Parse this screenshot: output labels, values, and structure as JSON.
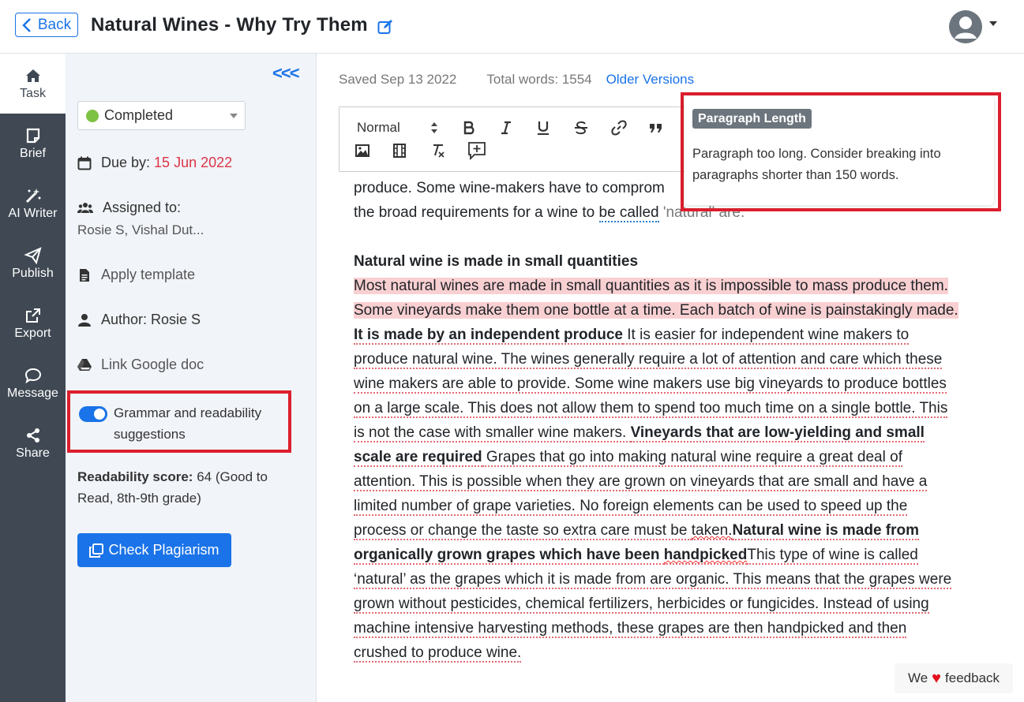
{
  "header": {
    "back_label": "Back",
    "title": "Natural Wines - Why Try Them"
  },
  "rail": {
    "items": [
      {
        "label": "Task",
        "icon": "home-icon"
      },
      {
        "label": "Brief",
        "icon": "note-icon"
      },
      {
        "label": "AI Writer",
        "icon": "magic-wand-icon"
      },
      {
        "label": "Publish",
        "icon": "send-icon"
      },
      {
        "label": "Export",
        "icon": "share-out-icon"
      },
      {
        "label": "Message",
        "icon": "chat-icon"
      },
      {
        "label": "Share",
        "icon": "share-icon"
      }
    ]
  },
  "panel": {
    "collapse_label": "<<<",
    "status": "Completed",
    "status_color": "#7dc243",
    "due_label": "Due by:",
    "due_date": "15 Jun 2022",
    "assigned_label": "Assigned to:",
    "assigned_names": "Rosie S, Vishal Dut...",
    "apply_template": "Apply template",
    "author": "Author: Rosie S",
    "link_google": "Link Google doc",
    "grammar_label": "Grammar and readability suggestions",
    "grammar_enabled": true,
    "readability_label": "Readability score:",
    "readability_value": "64 (Good to Read, 8th-9th grade)",
    "plagiarism_button": "Check Plagiarism"
  },
  "editor": {
    "saved": "Saved Sep 13 2022",
    "total_words": "Total words: 1554",
    "older_versions": "Older Versions",
    "toolbar": {
      "format_select": "Normal"
    },
    "line1": {
      "text": "produce. Some wine-makers have to comprom"
    },
    "line2": {
      "a": "the broad requirements for a wine to ",
      "b": "be called",
      "c": " 'natural' are:"
    },
    "heading": "Natural wine is made in small quantities",
    "hl_text": "Most natural wines are made in small quantities as it is impossible to mass produce them. Some vineyards make them one bottle at a time. Each batch of wine is painstakingly made.",
    "bold1": "It is made by an independent produce",
    "para1": " It is easier for independent wine makers to produce natural wine. The wines generally require a lot of attention and care which these wine makers are able to provide. Some wine makers use big vineyards to produce bottles on a large scale. This does not allow them to spend too much time on a single bottle. This is not the case with smaller wine makers. ",
    "bold2": "Vineyards that are low-yielding and small scale are required",
    "para2": " Grapes that go into making natural wine require a great deal of attention. This is possible when they are grown on vineyards that are small and have a limited number of grape varieties. No foreign elements can be used to speed up the process or change the taste so extra care must be ",
    "squig1": "taken.",
    "bold3a": "Natural wine is made from organically grown grapes which have been ",
    "squig2": "handpicked",
    "para3": "This type of wine is called ‘natural’ as the grapes which it is made from are organic. This means that the grapes were grown without pesticides, chemical fertilizers, herbicides or fungicides. Instead of using machine intensive harvesting methods, these grapes are then handpicked and then crushed to produce wine."
  },
  "tooltip": {
    "badge": "Paragraph Length",
    "text": "Paragraph too long. Consider breaking into paragraphs shorter than 150 words."
  },
  "feedback": {
    "pre": "We",
    "post": "feedback"
  }
}
